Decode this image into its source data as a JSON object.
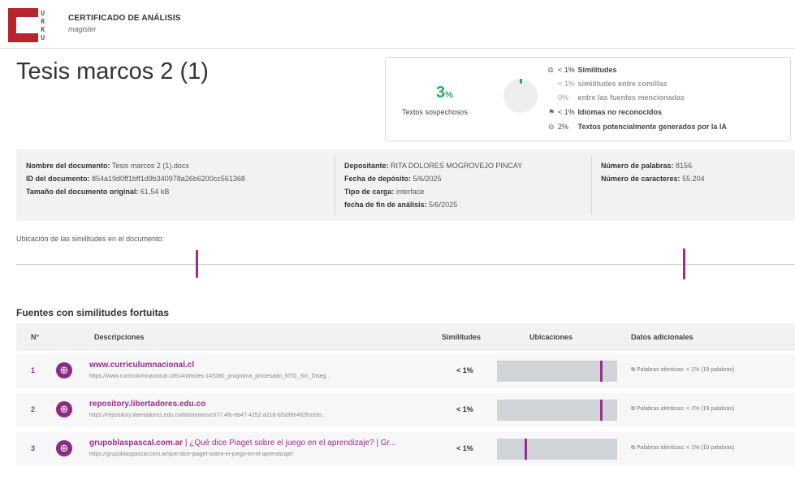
{
  "header": {
    "logo_letters": [
      "U",
      "R",
      "K",
      "U"
    ],
    "title": "CERTIFICADO DE ANÁLISIS",
    "subtitle": "magister"
  },
  "document": {
    "title": "Tesis marcos 2 (1)"
  },
  "summary": {
    "suspicious_value": "3",
    "suspicious_unit": "%",
    "suspicious_label": "Textos sospechosos",
    "accent_color": "#27ae60",
    "stats": [
      {
        "icon": "copy-icon",
        "value": "< 1%",
        "label": "Similitudes",
        "muted": false
      },
      {
        "icon": "",
        "value": "< 1%",
        "label": "similitudes entre comillas",
        "muted": true
      },
      {
        "icon": "",
        "value": "0%",
        "label": "entre las fuentes mencionadas",
        "muted": true
      },
      {
        "icon": "language-icon",
        "value": "< 1%",
        "label": "Idiomas no reconocidos",
        "muted": false
      },
      {
        "icon": "ai-icon",
        "value": "2%",
        "label": "Textos potencialmente generados por la IA",
        "muted": false
      }
    ]
  },
  "info": {
    "name_label": "Nombre del documento:",
    "name_value": "Tesis marcos 2 (1).docx",
    "id_label": "ID del documento:",
    "id_value": "854a19d0ff1bff1d9b340978a26b6200cc561368",
    "size_label": "Tamaño del documento original:",
    "size_value": "61,54 kB",
    "depositor_label": "Depositante:",
    "depositor_value": "RITA DOLORES MOGROVEJO PINCAY",
    "deposit_date_label": "Fecha de depósito:",
    "deposit_date_value": "5/6/2025",
    "upload_type_label": "Tipo de carga:",
    "upload_type_value": "interface",
    "analysis_end_label": "fecha de fin de análisis:",
    "analysis_end_value": "5/6/2025",
    "words_label": "Número de palabras:",
    "words_value": "8156",
    "chars_label": "Número de caracteres:",
    "chars_value": "55.204"
  },
  "location": {
    "label": "Ubicación de las similitudes en el documento:",
    "marks": [
      0.23,
      0.856
    ],
    "mark_color": "#9b2d8f"
  },
  "sources": {
    "title": "Fuentes con similitudes fortuitas",
    "headers": {
      "num": "N°",
      "desc": "Descripciones",
      "sim": "Similitudes",
      "loc": "Ubicaciones",
      "extra": "Datos adicionales"
    },
    "rows": [
      {
        "num": "1",
        "domain": "www.curriculumnacional.cl",
        "title_rest": "",
        "url": "https://www.curriculumnacional.cl/614/articles-145280_programa_procesado_NTG_Sin_Diseg...",
        "similarity": "< 1%",
        "marks": [
          0.86
        ],
        "extra": "Palabras idénticas: < 1% (19 palabras)"
      },
      {
        "num": "2",
        "domain": "repository.libertadores.edu.co",
        "title_rest": "",
        "url": "https://repository.libertadores.edu.co/bitstreams/c677 4fb-eb47-4252-a218-b5a96e482fce/do...",
        "similarity": "< 1%",
        "marks": [
          0.86
        ],
        "extra": "Palabras idénticas: < 1% (19 palabras)"
      },
      {
        "num": "3",
        "domain": "grupoblaspascal.com.ar",
        "title_rest": "| ¿Qué dice Piaget sobre el juego en el aprendizaje? | Gr...",
        "url": "https://grupoblaspascal.com.ar/que-dice-piaget-sobre-el-juego-en-el-aprendizaje/",
        "similarity": "< 1%",
        "marks": [
          0.23
        ],
        "extra": "Palabras idénticas: < 1% (10 palabras)"
      }
    ]
  }
}
